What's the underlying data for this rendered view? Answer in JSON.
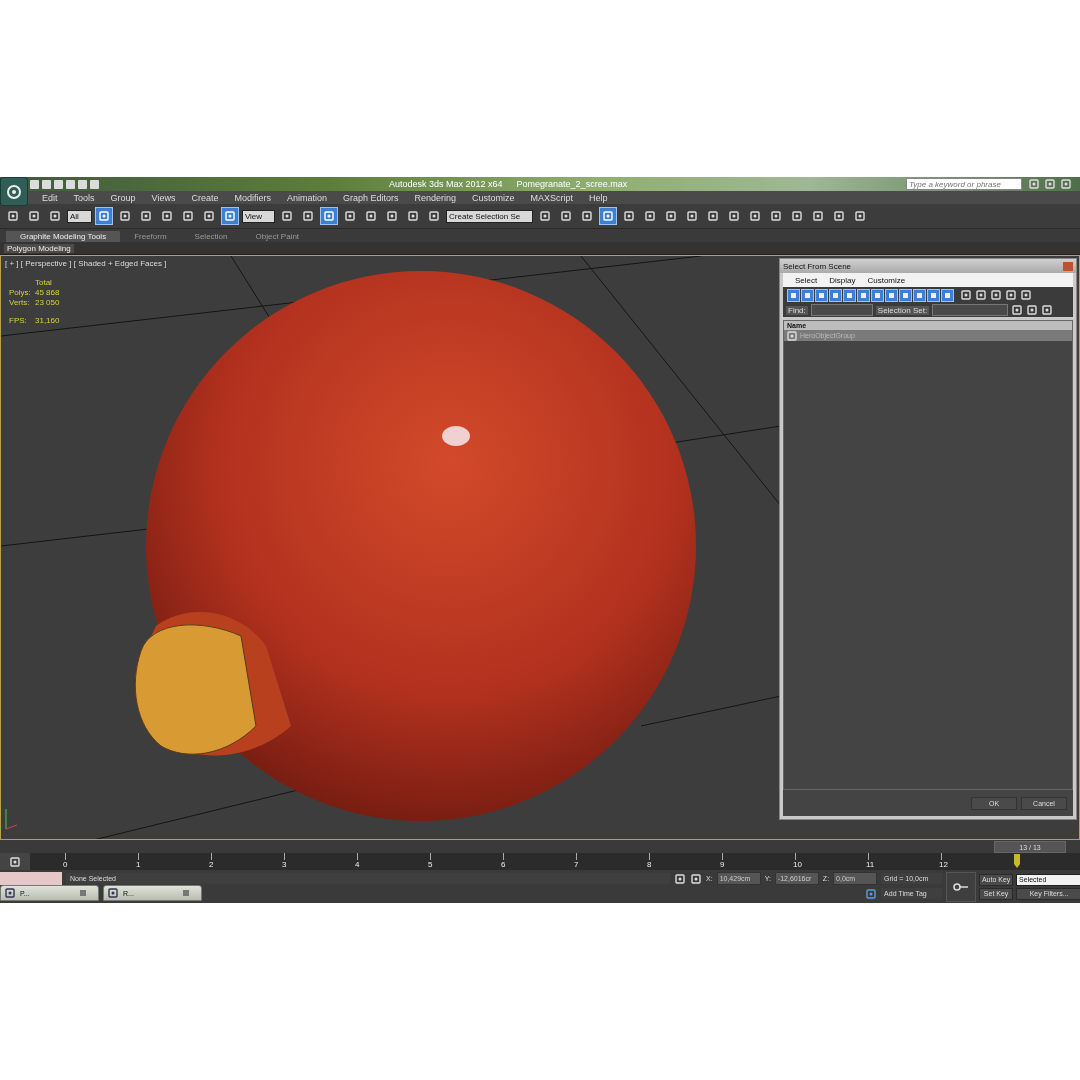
{
  "window": {
    "app_title": "Autodesk 3ds Max  2012 x64",
    "file_name": "Pomegranate_2_scree.max"
  },
  "search": {
    "placeholder": "Type a keyword or phrase"
  },
  "menu": [
    "Edit",
    "Tools",
    "Group",
    "Views",
    "Create",
    "Modifiers",
    "Animation",
    "Graph Editors",
    "Rendering",
    "Customize",
    "MAXScript",
    "Help"
  ],
  "toolbar": [
    {
      "kind": "button",
      "selected": false
    },
    {
      "kind": "button",
      "selected": false
    },
    {
      "kind": "button",
      "selected": false
    },
    {
      "kind": "dropdown",
      "value": "All"
    },
    {
      "kind": "button",
      "selected": true
    },
    {
      "kind": "button",
      "selected": false
    },
    {
      "kind": "button",
      "selected": false
    },
    {
      "kind": "button",
      "selected": false
    },
    {
      "kind": "button",
      "selected": false
    },
    {
      "kind": "button",
      "selected": false
    },
    {
      "kind": "button",
      "selected": true
    },
    {
      "kind": "dropdown",
      "value": "View"
    },
    {
      "kind": "button",
      "selected": false
    },
    {
      "kind": "button",
      "selected": false
    },
    {
      "kind": "button",
      "selected": true
    },
    {
      "kind": "button",
      "selected": false
    },
    {
      "kind": "button",
      "selected": false
    },
    {
      "kind": "button",
      "selected": false
    },
    {
      "kind": "button",
      "selected": false
    },
    {
      "kind": "button",
      "selected": false
    },
    {
      "kind": "dropdown",
      "value": "Create Selection Se"
    },
    {
      "kind": "button",
      "selected": false
    },
    {
      "kind": "button",
      "selected": false
    },
    {
      "kind": "button",
      "selected": false
    },
    {
      "kind": "button",
      "selected": true
    },
    {
      "kind": "button",
      "selected": false
    },
    {
      "kind": "button",
      "selected": false
    },
    {
      "kind": "button",
      "selected": false
    },
    {
      "kind": "button",
      "selected": false
    },
    {
      "kind": "button",
      "selected": false
    },
    {
      "kind": "button",
      "selected": false
    },
    {
      "kind": "button",
      "selected": false
    },
    {
      "kind": "button",
      "selected": false
    },
    {
      "kind": "button",
      "selected": false
    },
    {
      "kind": "button",
      "selected": false
    },
    {
      "kind": "button",
      "selected": false
    },
    {
      "kind": "button",
      "selected": false
    }
  ],
  "ribbon": {
    "tabs": [
      {
        "label": "Graphite Modeling Tools",
        "selected": true
      },
      {
        "label": "Freeform",
        "selected": false
      },
      {
        "label": "Selection",
        "selected": false
      },
      {
        "label": "Object Paint",
        "selected": false
      }
    ],
    "panel": "Polygon Modeling"
  },
  "viewport": {
    "label": "[ + ] [ Perspective ] [ Shaded + Edged Faces ]",
    "stats_header": "Total",
    "stats": [
      {
        "label": "Polys:",
        "value": "45 868"
      },
      {
        "label": "Verts:",
        "value": "23 050"
      }
    ],
    "fps": {
      "label": "FPS:",
      "value": "31,160"
    }
  },
  "dialog": {
    "title": "Select From Scene",
    "menu": [
      "Select",
      "Display",
      "Customize"
    ],
    "filters": [
      {
        "selected": true
      },
      {
        "selected": true
      },
      {
        "selected": true
      },
      {
        "selected": true
      },
      {
        "selected": true
      },
      {
        "selected": true
      },
      {
        "selected": true
      },
      {
        "selected": true
      },
      {
        "selected": true
      },
      {
        "selected": true
      },
      {
        "selected": true
      },
      {
        "selected": true
      }
    ],
    "find_label": "Find:",
    "selection_set_label": "Selection Set:",
    "column": "Name",
    "rows": [
      {
        "name": "HeroObjectGroup",
        "selected": true
      }
    ],
    "buttons": [
      "OK",
      "Cancel"
    ]
  },
  "time_slider": {
    "position": "13 / 13",
    "level": 1
  },
  "frames": [
    "0",
    "1",
    "2",
    "3",
    "4",
    "5",
    "6",
    "7",
    "8",
    "9",
    "10",
    "11",
    "12"
  ],
  "status": {
    "prompt": "None Selected",
    "x_label": "X:",
    "x": "10,429cm",
    "y_label": "Y:",
    "y": "-12,6016cr",
    "z_label": "Z:",
    "z": "0,0cm",
    "grid": "Grid = 10,0cm",
    "time_tag": "Add Time Tag",
    "auto_key": "Auto Key",
    "set_key": "Set Key",
    "key_mode": "Selected",
    "key_filters": "Key Filters..."
  },
  "taskbar": [
    {
      "label": "P..."
    },
    {
      "label": "R..."
    }
  ]
}
